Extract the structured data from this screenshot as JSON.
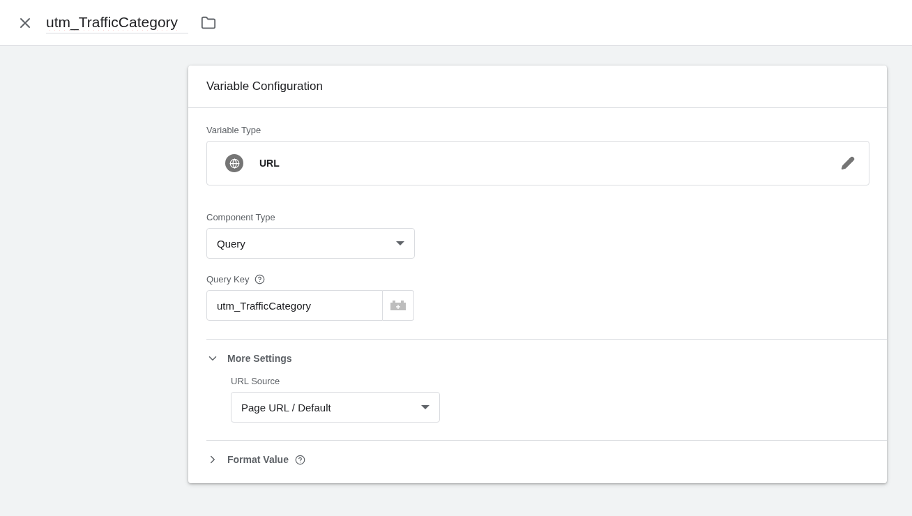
{
  "header": {
    "name": "utm_TrafficCategory"
  },
  "card": {
    "title": "Variable Configuration",
    "variable_type": {
      "label": "Variable Type",
      "value": "URL"
    },
    "component_type": {
      "label": "Component Type",
      "value": "Query"
    },
    "query_key": {
      "label": "Query Key",
      "value": "utm_TrafficCategory"
    },
    "sections": [
      {
        "title": "More Settings",
        "expanded": true,
        "help": false,
        "fields": [
          {
            "label": "URL Source",
            "value": "Page URL / Default"
          }
        ]
      },
      {
        "title": "Format Value",
        "expanded": false,
        "help": true
      }
    ]
  }
}
